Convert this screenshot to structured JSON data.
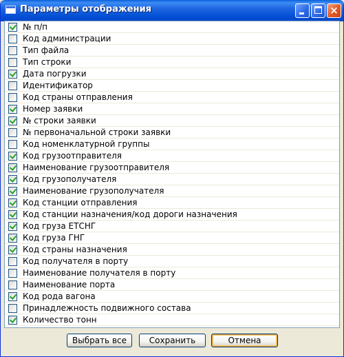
{
  "window": {
    "title": "Параметры отображения"
  },
  "items": [
    {
      "label": "№ п/п",
      "checked": true
    },
    {
      "label": "Код администрации",
      "checked": false
    },
    {
      "label": "Тип файла",
      "checked": false
    },
    {
      "label": "Тип строки",
      "checked": false
    },
    {
      "label": "Дата погрузки",
      "checked": true
    },
    {
      "label": "Идентификатор",
      "checked": false
    },
    {
      "label": "Код страны отправления",
      "checked": false
    },
    {
      "label": "Номер заявки",
      "checked": true
    },
    {
      "label": "№ строки заявки",
      "checked": true
    },
    {
      "label": "№ первоначальной строки заявки",
      "checked": false
    },
    {
      "label": "Код номенклатурной группы",
      "checked": false
    },
    {
      "label": "Код грузоотправителя",
      "checked": true
    },
    {
      "label": "Наименование грузоотправителя",
      "checked": true
    },
    {
      "label": "Код грузополучателя",
      "checked": true
    },
    {
      "label": "Наименование грузополучателя",
      "checked": true
    },
    {
      "label": "Код станции отправления",
      "checked": true
    },
    {
      "label": "Код станции назначения/код дороги назначения",
      "checked": true
    },
    {
      "label": "Код груза ЕТСНГ",
      "checked": true
    },
    {
      "label": "Код груза ГНГ",
      "checked": true
    },
    {
      "label": "Код страны назначения",
      "checked": true
    },
    {
      "label": "Код получателя в порту",
      "checked": false
    },
    {
      "label": "Наименование получателя в порту",
      "checked": false
    },
    {
      "label": "Наименование порта",
      "checked": false
    },
    {
      "label": "Код рода вагона",
      "checked": true
    },
    {
      "label": "Принадлежность подвижного состава",
      "checked": false
    },
    {
      "label": "Количество тонн",
      "checked": true
    }
  ],
  "buttons": {
    "select_all": "Выбрать все",
    "save": "Сохранить",
    "cancel": "Отмена"
  },
  "colors": {
    "titlebar": "#0054E3",
    "face": "#ECE9D8",
    "check": "#21A121",
    "close": "#E05A28"
  }
}
